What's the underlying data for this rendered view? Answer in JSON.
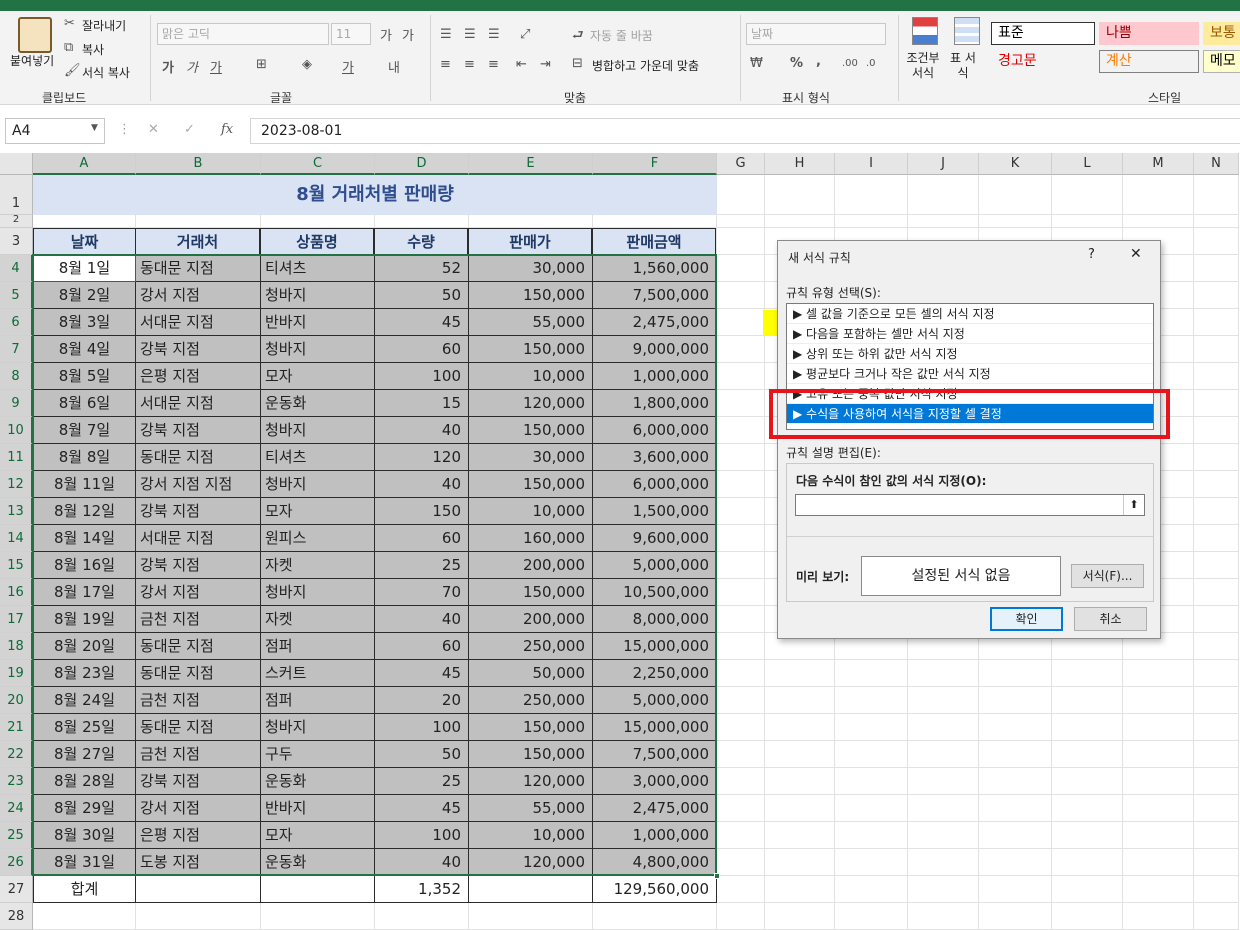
{
  "ribbon": {
    "clipboard": {
      "paste": "붙여넣기",
      "cut": "잘라내기",
      "copy": "복사",
      "format_painter": "서식 복사",
      "label": "클립보드"
    },
    "font": {
      "font_name": "맑은 고딕",
      "font_size": "11",
      "label": "글꼴"
    },
    "alignment": {
      "wrap_text": "자동 줄 바꿈",
      "merge_center": "병합하고 가운데 맞춤",
      "label": "맞춤"
    },
    "number": {
      "format": "날짜",
      "label": "표시 형식"
    },
    "styles": {
      "conditional_format": "조건부 서식",
      "table_format": "표 서식",
      "cell_styles": [
        "표준",
        "나쁨",
        "보통",
        "경고문",
        "계산",
        "메모"
      ],
      "label": "스타일"
    }
  },
  "formula_bar": {
    "name_box": "A4",
    "fx": "fx",
    "content": "2023-08-01"
  },
  "sheet": {
    "columns": [
      "A",
      "B",
      "C",
      "D",
      "E",
      "F",
      "G",
      "H",
      "I",
      "J",
      "K",
      "L",
      "M",
      "N"
    ],
    "title": "8월 거래처별 판매량",
    "headers": [
      "날짜",
      "거래처",
      "상품명",
      "수량",
      "판매가",
      "판매금액"
    ],
    "rows": [
      [
        "8월 1일",
        "동대문 지점",
        "티셔츠",
        "52",
        "30,000",
        "1,560,000"
      ],
      [
        "8월 2일",
        "강서 지점",
        "청바지",
        "50",
        "150,000",
        "7,500,000"
      ],
      [
        "8월 3일",
        "서대문 지점",
        "반바지",
        "45",
        "55,000",
        "2,475,000"
      ],
      [
        "8월 4일",
        "강북 지점",
        "청바지",
        "60",
        "150,000",
        "9,000,000"
      ],
      [
        "8월 5일",
        "은평 지점",
        "모자",
        "100",
        "10,000",
        "1,000,000"
      ],
      [
        "8월 6일",
        "서대문 지점",
        "운동화",
        "15",
        "120,000",
        "1,800,000"
      ],
      [
        "8월 7일",
        "강북 지점",
        "청바지",
        "40",
        "150,000",
        "6,000,000"
      ],
      [
        "8월 8일",
        "동대문 지점",
        "티셔츠",
        "120",
        "30,000",
        "3,600,000"
      ],
      [
        "8월 11일",
        "강서 지점 지점",
        "청바지",
        "40",
        "150,000",
        "6,000,000"
      ],
      [
        "8월 12일",
        "강북 지점",
        "모자",
        "150",
        "10,000",
        "1,500,000"
      ],
      [
        "8월 14일",
        "서대문 지점",
        "원피스",
        "60",
        "160,000",
        "9,600,000"
      ],
      [
        "8월 16일",
        "강북 지점",
        "자켓",
        "25",
        "200,000",
        "5,000,000"
      ],
      [
        "8월 17일",
        "강서 지점",
        "청바지",
        "70",
        "150,000",
        "10,500,000"
      ],
      [
        "8월 19일",
        "금천 지점",
        "자켓",
        "40",
        "200,000",
        "8,000,000"
      ],
      [
        "8월 20일",
        "동대문 지점",
        "점퍼",
        "60",
        "250,000",
        "15,000,000"
      ],
      [
        "8월 23일",
        "동대문 지점",
        "스커트",
        "45",
        "50,000",
        "2,250,000"
      ],
      [
        "8월 24일",
        "금천 지점",
        "점퍼",
        "20",
        "250,000",
        "5,000,000"
      ],
      [
        "8월 25일",
        "동대문 지점",
        "청바지",
        "100",
        "150,000",
        "15,000,000"
      ],
      [
        "8월 27일",
        "금천 지점",
        "구두",
        "50",
        "150,000",
        "7,500,000"
      ],
      [
        "8월 28일",
        "강북 지점",
        "운동화",
        "25",
        "120,000",
        "3,000,000"
      ],
      [
        "8월 29일",
        "강서 지점",
        "반바지",
        "45",
        "55,000",
        "2,475,000"
      ],
      [
        "8월 30일",
        "은평 지점",
        "모자",
        "100",
        "10,000",
        "1,000,000"
      ],
      [
        "8월 31일",
        "도봉 지점",
        "운동화",
        "40",
        "120,000",
        "4,800,000"
      ]
    ],
    "total": {
      "label": "합계",
      "qty": "1,352",
      "amount": "129,560,000"
    }
  },
  "dialog": {
    "title": "새 서식 규칙",
    "help": "?",
    "close": "✕",
    "rule_type_label": "규칙 유형 선택(S):",
    "rule_types": [
      "▶ 셀 값을 기준으로 모든 셀의 서식 지정",
      "▶ 다음을 포함하는 셀만 서식 지정",
      "▶ 상위 또는 하위 값만 서식 지정",
      "▶ 평균보다 크거나 작은 값만 서식 지정",
      "▶ 고유 또는 중복 값만 서식 지정",
      "▶ 수식을 사용하여 서식을 지정할 셀 결정"
    ],
    "selected_rule_index": 5,
    "edit_label": "규칙 설명 편집(E):",
    "formula_label": "다음 수식이 참인 값의 서식 지정(O):",
    "formula_value": "",
    "preview_label": "미리 보기:",
    "preview_text": "설정된 서식 없음",
    "format_button": "서식(F)...",
    "ok": "확인",
    "cancel": "취소"
  },
  "colors": {
    "excel_green": "#217346",
    "selection_blue": "#0078d7",
    "highlight_red": "#e8141b",
    "title_fill": "#dae3f3",
    "grey_fill": "#c0c0c0"
  }
}
